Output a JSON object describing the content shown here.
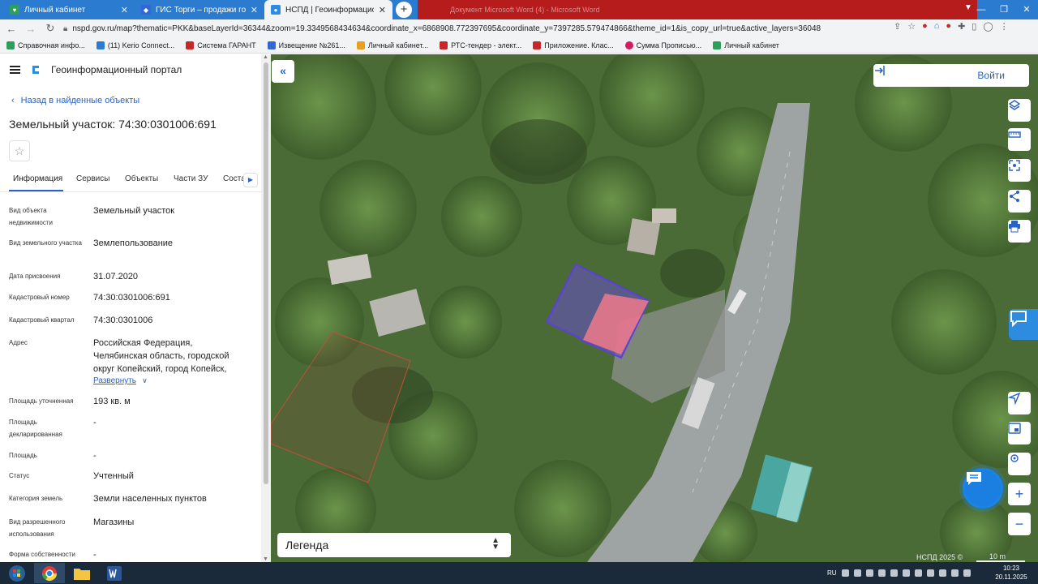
{
  "browser": {
    "tabs": [
      {
        "title": "Личный кабинет",
        "favicon_color": "#2e9e5b",
        "active": false
      },
      {
        "title": "ГИС Торги – продажи государс",
        "favicon_color": "#3367d6",
        "active": false
      },
      {
        "title": "НСПД | Геоинформационный п",
        "favicon_color": "#2d8be0",
        "active": true
      }
    ],
    "new_tab_label": "+",
    "background_window_title": "Документ Microsoft Word (4) - Microsoft Word",
    "url": "nspd.gov.ru/map?thematic=PKK&baseLayerId=36344&zoom=19.3349568434634&coordinate_x=6868908.772397695&coordinate_y=7397285.579474866&theme_id=1&is_copy_url=true&active_layers=36048",
    "bookmarks": [
      {
        "label": "Справочная инфо...",
        "color": "#2e9e5b"
      },
      {
        "label": "(11) Kerio Connect...",
        "color": "#2b7bd0"
      },
      {
        "label": "Система ГАРАНТ",
        "color": "#c62828"
      },
      {
        "label": "Извещение №261...",
        "color": "#3367d6"
      },
      {
        "label": "Личный кабинет...",
        "color": "#e8a020"
      },
      {
        "label": "РТС-тендер - элект...",
        "color": "#c62828"
      },
      {
        "label": "Приложение. Клас...",
        "color": "#c62828"
      },
      {
        "label": "Сумма Прописью...",
        "color": "#d81b60"
      },
      {
        "label": "Личный кабинет",
        "color": "#2e9e5b"
      }
    ]
  },
  "panel": {
    "portal_name": "Геоинформационный портал",
    "back_link": "Назад в найденные объекты",
    "title": "Земельный участок: 74:30:0301006:691",
    "tabs": [
      "Информация",
      "Сервисы",
      "Объекты",
      "Части ЗУ",
      "Соста"
    ],
    "active_tab": "Информация",
    "fields": [
      {
        "label": "Вид объекта недвижимости",
        "value": "Земельный участок"
      },
      {
        "label": "Вид земельного участка",
        "value": "Землепользование"
      },
      {
        "label": "Дата присвоения",
        "value": "31.07.2020"
      },
      {
        "label": "Кадастровый номер",
        "value": "74:30:0301006:691"
      },
      {
        "label": "Кадастровый квартал",
        "value": "74:30:0301006"
      },
      {
        "label": "Адрес",
        "value": "Российская Федерация, Челябинская область, городской округ Копейский, город Копейск,"
      },
      {
        "label": "Площадь уточненная",
        "value": "193 кв. м"
      },
      {
        "label": "Площадь декларированная",
        "value": "-"
      },
      {
        "label": "Площадь",
        "value": "-"
      },
      {
        "label": "Статус",
        "value": "Учтенный"
      },
      {
        "label": "Категория земель",
        "value": "Земли населенных пунктов"
      },
      {
        "label": "Вид разрешенного использования",
        "value": "Магазины"
      },
      {
        "label": "Форма собственности",
        "value": "-"
      }
    ],
    "expand_link": "Развернуть"
  },
  "map": {
    "login_label": "Войти",
    "legend_label": "Легенда",
    "attribution": "НСПД 2025 ©",
    "scale_label": "10 m",
    "colors": {
      "parcel_stroke": "#5b3fe0",
      "parcel_fill": "#6a4fd0",
      "building_fill": "#f07a8a",
      "other_parcel": "#c0503a"
    }
  },
  "taskbar": {
    "lang": "RU",
    "time": "10:23",
    "date": "20.11.2025"
  }
}
